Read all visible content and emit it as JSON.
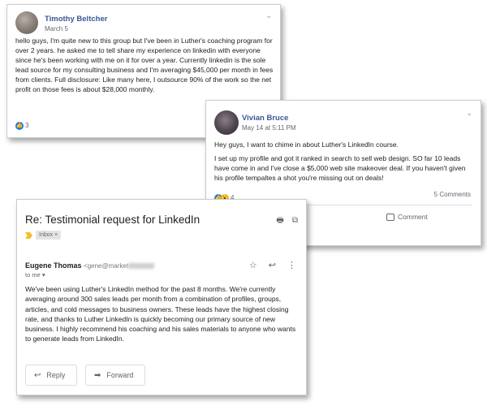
{
  "post1": {
    "author": "Timothy Beltcher",
    "date": "March 5",
    "body": "hello guys, I'm quite new to this group but I've been in Luther's coaching program for over 2 years. he asked me to tell share my experience on linkedin with everyone since he's been working with me on it for over a year. Currently linkedin is the sole lead source for my consulting business and I'm averaging $45,000 per month in fees from clients. Full disclosure: Like many here, I outsource 90% of the work so the net profit on those fees is about $28,000 monthly.",
    "reaction_count": "3"
  },
  "post2": {
    "author": "Vivian Bruce",
    "date": "May 14 at 5:11 PM",
    "para1": "Hey guys, I want to chime in about Luther's LinkedIn course.",
    "para2": "I set up my profile and got it ranked in search to sell web design. SO far 10 leads have come in and I've close a $5,000 web site makeover deal. If you haven't given his profile tempaltes a shot you're missing out on deals!",
    "comments": "5 Comments",
    "comment_label": "Comment"
  },
  "email": {
    "subject": "Re: Testimonial request for LinkedIn",
    "label_chip": "Inbox ×",
    "sender_name": "Eugene Thomas",
    "sender_addr": "<gene@market",
    "to_line": "to me ▾",
    "body": "We've been using Luther's LinkedIn method for the past 8 months. We're currently averaging around 300 sales leads per month from a combination of profiles, groups, articles, and cold messages to business owners. These leads have the highest closing rate, and thanks to Luther LinkedIn is quickly becoming our primary source of new business. I highly recommend his coaching and his sales materials to anyone who wants to generate leads from LinkedIn.",
    "reply_label": "Reply",
    "forward_label": "Forward"
  },
  "colors": {
    "fb_name": "#385898",
    "fb_like": "#1877f2",
    "label_yellow": "#f2c026"
  }
}
